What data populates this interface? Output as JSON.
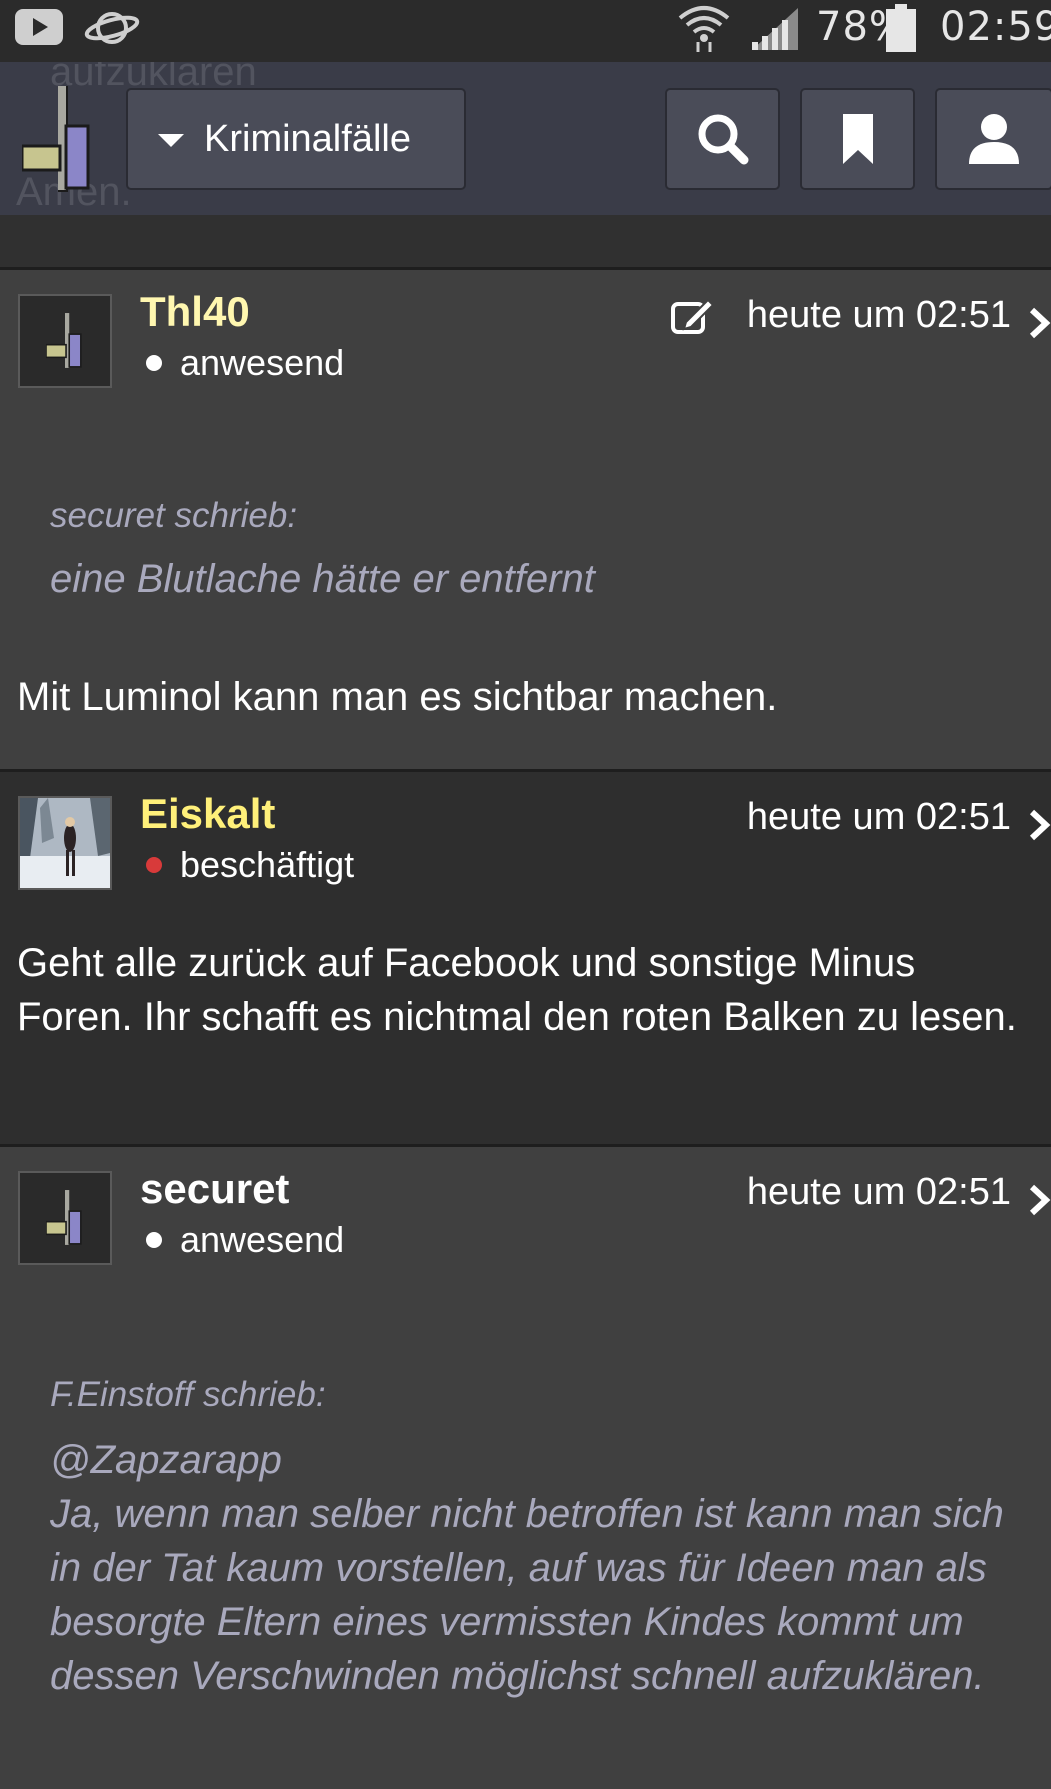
{
  "status_bar": {
    "battery": "78%",
    "time": "02:59"
  },
  "topnav": {
    "ghost_text_1": "aufzuklären",
    "ghost_text_2": "Amen.",
    "category_label": "Kriminalfälle"
  },
  "posts": [
    {
      "username": "Thl40",
      "username_color": "#fff7b0",
      "status": "anwesend",
      "status_color": "#ffffff",
      "timestamp": "heute um 02:51",
      "quote": {
        "author": "securet schrieb:",
        "text": "eine Blutlache hätte er entfernt"
      },
      "body": "Mit Luminol kann man es sichtbar machen."
    },
    {
      "username": "Eiskalt",
      "username_color": "#fff07a",
      "status": "beschäftigt",
      "status_color": "#d83a3a",
      "timestamp": "heute um 02:51",
      "body": "Geht alle zurück auf Facebook und sonstige Minus Foren. Ihr schafft es nichtmal den roten Balken zu lesen."
    },
    {
      "username": "securet",
      "username_color": "#ffffff",
      "status": "anwesend",
      "status_color": "#ffffff",
      "timestamp": "heute um 02:51",
      "quote": {
        "author": "F.Einstoff schrieb:",
        "text": "@Zapzarapp\nJa, wenn man selber nicht betroffen ist kann man sich in der Tat kaum vorstellen, auf was für Ideen man als besorgte Eltern eines vermissten Kindes kommt um dessen Verschwinden möglichst schnell aufzuklären."
      }
    }
  ]
}
